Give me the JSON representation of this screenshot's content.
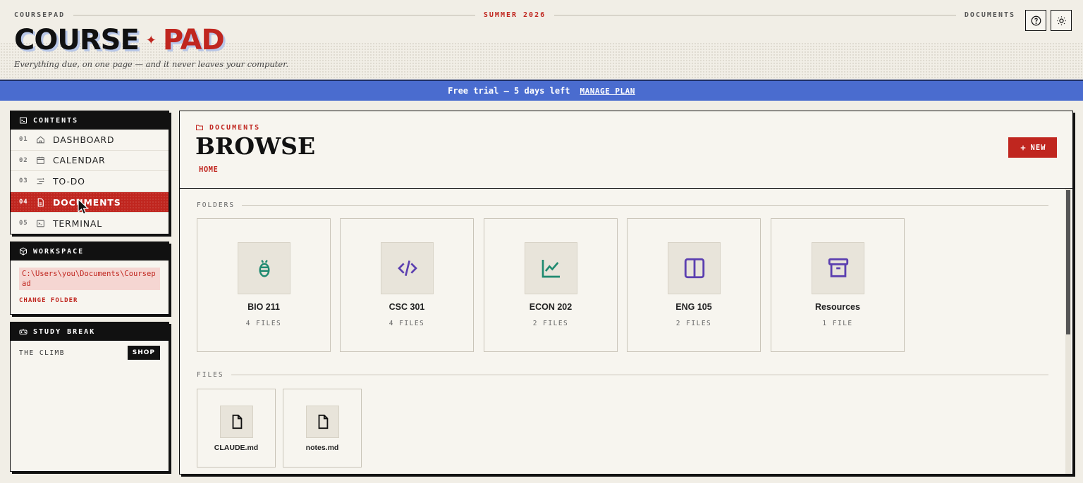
{
  "header": {
    "brand_small": "COURSEPAD",
    "season": "SUMMER 2026",
    "section": "DOCUMENTS",
    "logo_word1": "COURSE",
    "logo_star": "✦",
    "logo_word2": "PAD",
    "tagline": "Everything due, on one page — and it never leaves your computer.",
    "help_icon": "help-circle-icon",
    "theme_icon": "sun-icon"
  },
  "banner": {
    "text": "Free trial — 5 days left",
    "link": "MANAGE PLAN"
  },
  "contents": {
    "title": "CONTENTS",
    "items": [
      {
        "num": "01",
        "label": "DASHBOARD",
        "icon": "home-icon"
      },
      {
        "num": "02",
        "label": "CALENDAR",
        "icon": "calendar-icon"
      },
      {
        "num": "03",
        "label": "TO-DO",
        "icon": "list-icon"
      },
      {
        "num": "04",
        "label": "DOCUMENTS",
        "icon": "document-icon",
        "active": true
      },
      {
        "num": "05",
        "label": "TERMINAL",
        "icon": "terminal-icon"
      }
    ]
  },
  "workspace": {
    "title": "WORKSPACE",
    "path": "C:\\Users\\you\\Documents\\Coursepad",
    "change_label": "CHANGE FOLDER"
  },
  "study_break": {
    "title": "STUDY BREAK",
    "game": "THE CLIMB",
    "shop_label": "SHOP"
  },
  "main": {
    "crumb": "DOCUMENTS",
    "title": "BROWSE",
    "home_link": "HOME",
    "new_label": "NEW",
    "folders_label": "FOLDERS",
    "files_label": "FILES",
    "folders": [
      {
        "name": "BIO 211",
        "count": "4 FILES",
        "icon": "bug-icon",
        "color": "#1f8a70"
      },
      {
        "name": "CSC 301",
        "count": "4 FILES",
        "icon": "code-icon",
        "color": "#5b3fb0"
      },
      {
        "name": "ECON 202",
        "count": "2 FILES",
        "icon": "chart-line-icon",
        "color": "#1f8a70"
      },
      {
        "name": "ENG 105",
        "count": "2 FILES",
        "icon": "book-open-icon",
        "color": "#5b3fb0"
      },
      {
        "name": "Resources",
        "count": "1 FILE",
        "icon": "archive-icon",
        "color": "#5b3fb0"
      }
    ],
    "files": [
      {
        "name": "CLAUDE.md",
        "icon": "file-icon"
      },
      {
        "name": "notes.md",
        "icon": "file-icon"
      }
    ]
  },
  "colors": {
    "accent": "#c0261f",
    "banner": "#4a6ccf",
    "ink": "#111111",
    "paper": "#f7f5ef"
  }
}
